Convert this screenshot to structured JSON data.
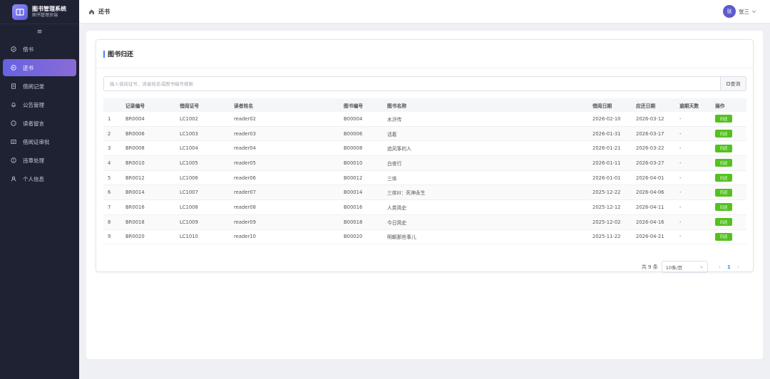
{
  "brand": {
    "title": "图书管理系统",
    "subtitle": "图书管理员端"
  },
  "sidebar": {
    "items": [
      {
        "label": "借书",
        "icon": "check-circle-icon"
      },
      {
        "label": "还书",
        "icon": "return-circle-icon",
        "active": true
      },
      {
        "label": "借阅记录",
        "icon": "document-icon"
      },
      {
        "label": "公告管理",
        "icon": "bell-icon"
      },
      {
        "label": "读者留言",
        "icon": "chat-icon"
      },
      {
        "label": "借阅证审批",
        "icon": "card-check-icon"
      },
      {
        "label": "违章处理",
        "icon": "warning-icon"
      },
      {
        "label": "个人信息",
        "icon": "user-icon"
      }
    ]
  },
  "header": {
    "title": "还书",
    "user": {
      "avatar": "张",
      "name": "张三"
    }
  },
  "card": {
    "title": "图书归还"
  },
  "search": {
    "placeholder": "输入借阅证号、读者姓名或图书编号搜索",
    "button": "查询"
  },
  "table": {
    "columns": [
      "",
      "记录编号",
      "借阅证号",
      "读者姓名",
      "图书编号",
      "图书名称",
      "借阅日期",
      "应还日期",
      "逾期天数",
      "操作"
    ],
    "rows": [
      [
        "1",
        "BR0004",
        "LC1002",
        "reader02",
        "B00004",
        "水浒传",
        "2026-02-10",
        "2026-03-12",
        "-",
        "归还"
      ],
      [
        "2",
        "BR0006",
        "LC1003",
        "reader03",
        "B00006",
        "活着",
        "2026-01-31",
        "2026-03-17",
        "-",
        "归还"
      ],
      [
        "3",
        "BR0008",
        "LC1004",
        "reader04",
        "B00008",
        "追风筝的人",
        "2026-01-21",
        "2026-03-22",
        "-",
        "归还"
      ],
      [
        "4",
        "BR0010",
        "LC1005",
        "reader05",
        "B00010",
        "白夜行",
        "2026-01-11",
        "2026-03-27",
        "-",
        "归还"
      ],
      [
        "5",
        "BR0012",
        "LC1006",
        "reader06",
        "B00012",
        "三体",
        "2026-01-01",
        "2026-04-01",
        "-",
        "归还"
      ],
      [
        "6",
        "BR0014",
        "LC1007",
        "reader07",
        "B00014",
        "三体III：死神永生",
        "2025-12-22",
        "2026-04-06",
        "-",
        "归还"
      ],
      [
        "7",
        "BR0016",
        "LC1008",
        "reader08",
        "B00016",
        "人类简史",
        "2025-12-12",
        "2026-04-11",
        "-",
        "归还"
      ],
      [
        "8",
        "BR0018",
        "LC1009",
        "reader09",
        "B00018",
        "今日简史",
        "2025-12-02",
        "2026-04-16",
        "-",
        "归还"
      ],
      [
        "9",
        "BR0020",
        "LC1010",
        "reader10",
        "B00020",
        "明朝那些事儿",
        "2025-11-22",
        "2026-04-21",
        "-",
        "归还"
      ]
    ]
  },
  "pagination": {
    "total": "共 9 条",
    "page_size": "10条/页",
    "current": "1"
  },
  "colors": {
    "sidebar_bg": "#1f2233",
    "active_nav": "#6663e0",
    "return_button": "#53c11f",
    "accent": "#4a7dff"
  }
}
